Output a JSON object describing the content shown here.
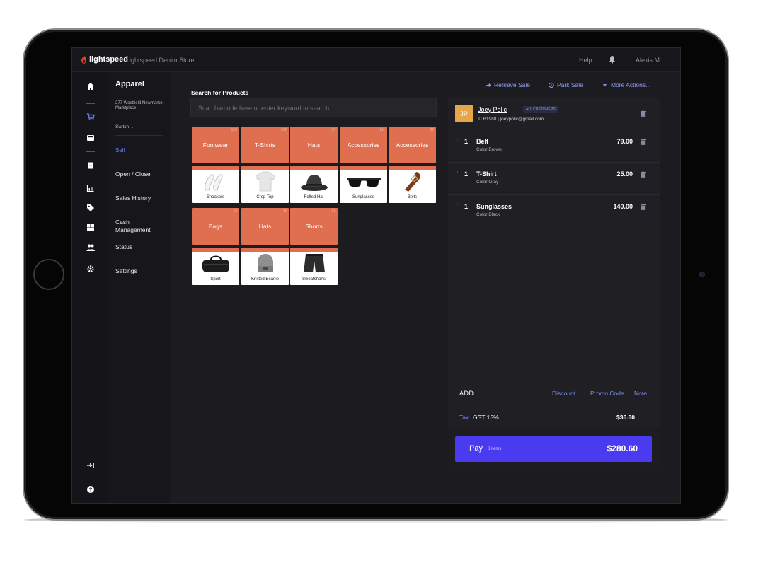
{
  "topbar": {
    "brand": "lightspeed",
    "store_name": "Lightspeed Denim Store",
    "help": "Help",
    "user": "Alexis M"
  },
  "rail": {
    "icons": [
      "home-icon",
      "cart-icon",
      "register-icon",
      "receipt-icon",
      "reports-icon",
      "tag-icon",
      "inventory-icon",
      "customers-icon",
      "settings-icon",
      "collapse-icon",
      "help-icon"
    ]
  },
  "submenu": {
    "title": "Apparel",
    "address": "277 Westfield Newmarket - Marktplace",
    "switch": "Switch",
    "items": [
      "Sell",
      "Open / Close",
      "Sales History",
      "Cash Management",
      "Status",
      "Settings"
    ]
  },
  "search": {
    "label": "Search for Products",
    "placeholder": "Scan barcode here or enter keyword to search..."
  },
  "categories": [
    {
      "label": "Footwear",
      "count": "125"
    },
    {
      "label": "T-Shirts",
      "count": "107"
    },
    {
      "label": "Hats",
      "count": "35"
    },
    {
      "label": "Accessories",
      "count": "111"
    },
    {
      "label": "Accessories",
      "count": "32"
    },
    {
      "label": "Bags",
      "count": "12"
    },
    {
      "label": "Hats",
      "count": "46"
    },
    {
      "label": "Shorts",
      "count": "21"
    }
  ],
  "products": [
    {
      "name": "Sneakers"
    },
    {
      "name": "Crop Top"
    },
    {
      "name": "Felted Hat"
    },
    {
      "name": "Sunglasses"
    },
    {
      "name": "Belts"
    },
    {
      "name": "Sport"
    },
    {
      "name": "Knitted Beanie"
    },
    {
      "name": "Sweatshorts"
    }
  ],
  "actions": {
    "retrieve": "Retrieve Sale",
    "park": "Park Sale",
    "more": "More Actions..."
  },
  "customer": {
    "initials": "JP",
    "name": "Joey Polic",
    "badge": "ALL CUSTOMERS",
    "meta": "TLB1988 | joeypolic@gmail.com"
  },
  "lines": [
    {
      "qty": "1",
      "name": "Belt",
      "sub": "Color Brown",
      "price": "79.00"
    },
    {
      "qty": "1",
      "name": "T-Shirt",
      "sub": "Color Gray",
      "price": "25.00"
    },
    {
      "qty": "1",
      "name": "Sunglasses",
      "sub": "Color Black",
      "price": "140.00"
    }
  ],
  "add": {
    "label": "ADD",
    "discount": "Discount",
    "promo": "Promo Code",
    "note": "Note"
  },
  "tax": {
    "label": "Tax",
    "name": "GST 15%",
    "amount": "$36.60"
  },
  "pay": {
    "label": "Pay",
    "items": "3 items",
    "total": "$280.60"
  },
  "colors": {
    "accent": "#4b3bf0",
    "link": "#7d8cf6",
    "tile": "#e06f50",
    "brand_red": "#e8412e",
    "avatar": "#e6a64b"
  }
}
